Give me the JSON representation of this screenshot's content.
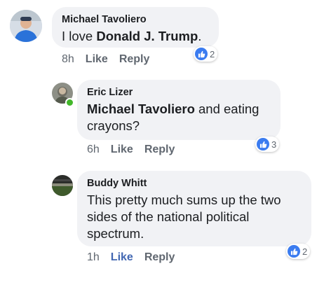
{
  "comments": [
    {
      "author": "Michael Tavoliero",
      "text_before": "I love ",
      "mention": "Donald J. Trump",
      "text_after": ".",
      "time": "8h",
      "like_label": "Like",
      "reply_label": "Reply",
      "reaction_count": "2"
    },
    {
      "author": "Eric Lizer",
      "mention": "Michael Tavoliero",
      "text_after": " and eating crayons?",
      "time": "6h",
      "like_label": "Like",
      "reply_label": "Reply",
      "reaction_count": "3"
    },
    {
      "author": "Buddy Whitt",
      "text": "This pretty much sums up the two sides of the national political spectrum.",
      "time": "1h",
      "like_label": "Like",
      "reply_label": "Reply",
      "reaction_count": "2"
    }
  ],
  "colors": {
    "bubble": "#f1f2f5",
    "link_blue": "#4267b2",
    "like_badge": "#3b7cf0",
    "online": "#42b72a"
  }
}
